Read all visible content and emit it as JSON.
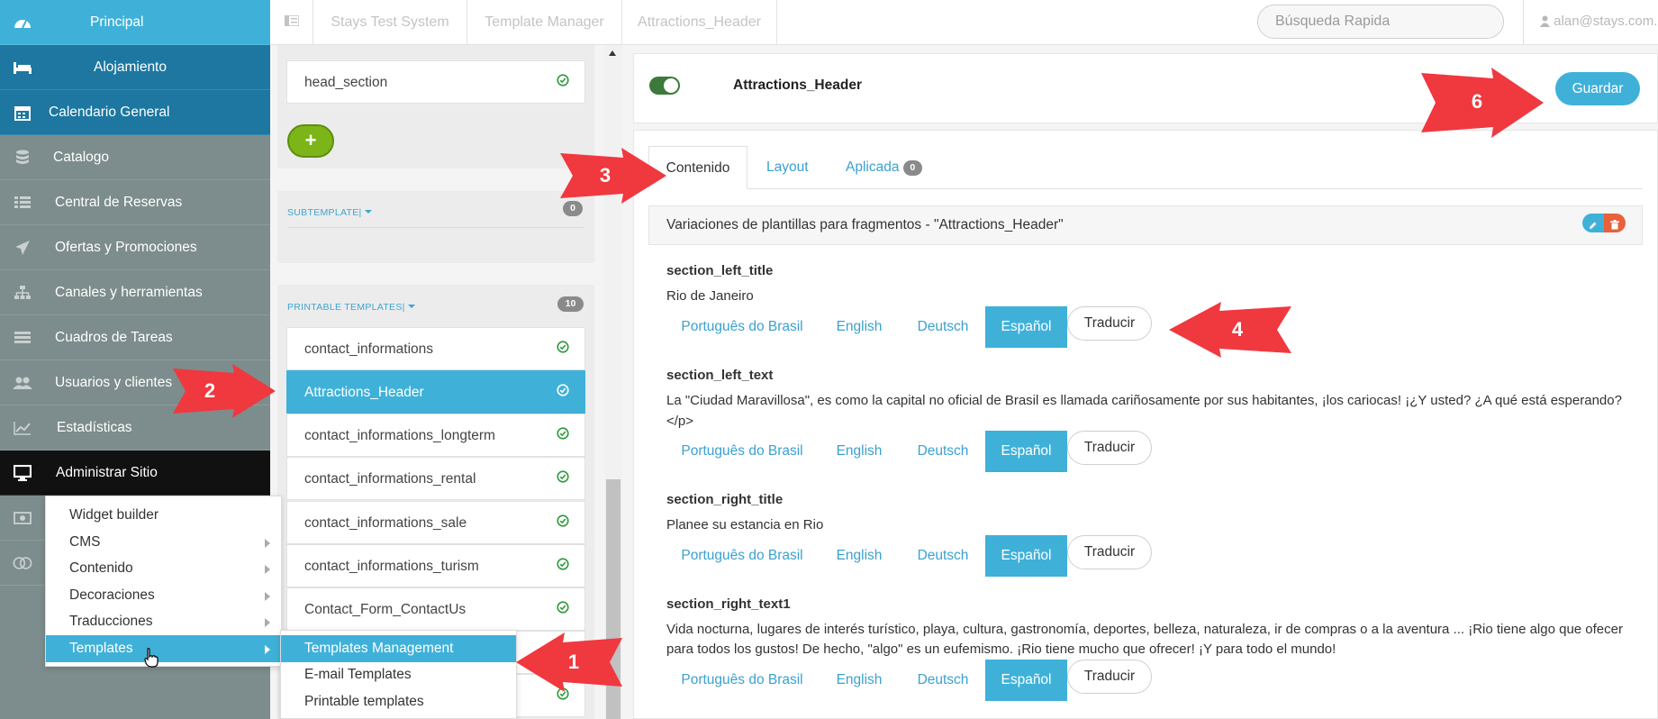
{
  "sidebar": {
    "items": [
      {
        "label": "Principal",
        "icon": "dashboard-icon",
        "bg": "#3fb1d9"
      },
      {
        "label": "Alojamiento",
        "icon": "bed-icon",
        "bg": "#1d77a0"
      },
      {
        "label": "Calendario General",
        "icon": "calendar-icon",
        "bg": "#1d77a0"
      },
      {
        "label": "Catalogo",
        "icon": "database-icon",
        "bg": "#7d8c8c"
      },
      {
        "label": "Central de Reservas",
        "icon": "list-icon",
        "bg": "#7d8c8c"
      },
      {
        "label": "Ofertas y Promociones",
        "icon": "paper-plane-icon",
        "bg": "#7d8c8c"
      },
      {
        "label": "Canales y herramientas",
        "icon": "sitemap-icon",
        "bg": "#7d8c8c"
      },
      {
        "label": "Cuadros de Tareas",
        "icon": "tasks-icon",
        "bg": "#7d8c8c"
      },
      {
        "label": "Usuarios y clientes",
        "icon": "users-icon",
        "bg": "#7d8c8c"
      },
      {
        "label": "Estadísticas",
        "icon": "line-chart-icon",
        "bg": "#7d8c8c"
      },
      {
        "label": "Administrar Sitio",
        "icon": "desktop-icon",
        "bg": "#111111"
      }
    ]
  },
  "topbar": {
    "breadcrumbs": [
      "Stays Test System",
      "Template Manager",
      "Attractions_Header"
    ],
    "search_placeholder": "Búsqueda Rapida",
    "user": "alan@stays.com.b"
  },
  "middle": {
    "top_item": "head_section",
    "add_label": "+",
    "subtemplate_header": "SUBTEMPLATE|",
    "subtemplate_count": "0",
    "printable_header": "PRINTABLE TEMPLATES|",
    "printable_count": "10",
    "templates": [
      {
        "name": "contact_informations",
        "active": false
      },
      {
        "name": "Attractions_Header",
        "active": true
      },
      {
        "name": "contact_informations_longterm",
        "active": false
      },
      {
        "name": "contact_informations_rental",
        "active": false
      },
      {
        "name": "contact_informations_sale",
        "active": false
      },
      {
        "name": "contact_informations_turism",
        "active": false
      },
      {
        "name": "Contact_Form_ContactUs",
        "active": false
      }
    ]
  },
  "main": {
    "title": "Attractions_Header",
    "save_label": "Guardar",
    "tabs": {
      "contenido": "Contenido",
      "layout": "Layout",
      "aplicada": "Aplicada",
      "aplicada_count": "0"
    },
    "variations_title": "Variaciones de plantillas para fragmentos - \"Attractions_Header\"",
    "languages": [
      "Português do Brasil",
      "English",
      "Deutsch",
      "Español"
    ],
    "translate_label": "Traducir",
    "fields": [
      {
        "name": "section_left_title",
        "lines": [
          "Rio de Janeiro"
        ]
      },
      {
        "name": "section_left_text",
        "lines": [
          "La \"Ciudad Maravillosa\", es como la capital no oficial de Brasil es llamada cariñosamente por sus habitantes, ¡los cariocas! ¡¿Y usted? ¿A qué está esperando?",
          "</p>"
        ]
      },
      {
        "name": "section_right_title",
        "lines": [
          "Planee su estancia en Rio"
        ]
      },
      {
        "name": "section_right_text1",
        "lines": [
          "Vida nocturna, lugares de interés turístico, playa, cultura, gastronomía, deportes, belleza, naturaleza, ir de compras o a la aventura ... ¡Rio tiene algo que ofecer",
          "para todos los gustos! De hecho, \"algo\" es un eufemismo. ¡Rio tiene mucho que ofrecer! ¡Y para todo el mundo!"
        ]
      }
    ]
  },
  "menus": {
    "admin": [
      "Widget builder",
      "CMS",
      "Contenido",
      "Decoraciones",
      "Traducciones",
      "Templates"
    ],
    "templates": [
      "Templates Management",
      "E-mail Templates",
      "Printable templates"
    ]
  },
  "callouts": [
    "1",
    "2",
    "3",
    "4",
    "6"
  ],
  "colors": {
    "accent": "#3fb1d9",
    "callout": "#f0383f",
    "toggle": "#3c7a3b",
    "add_button": "#7cb518"
  }
}
